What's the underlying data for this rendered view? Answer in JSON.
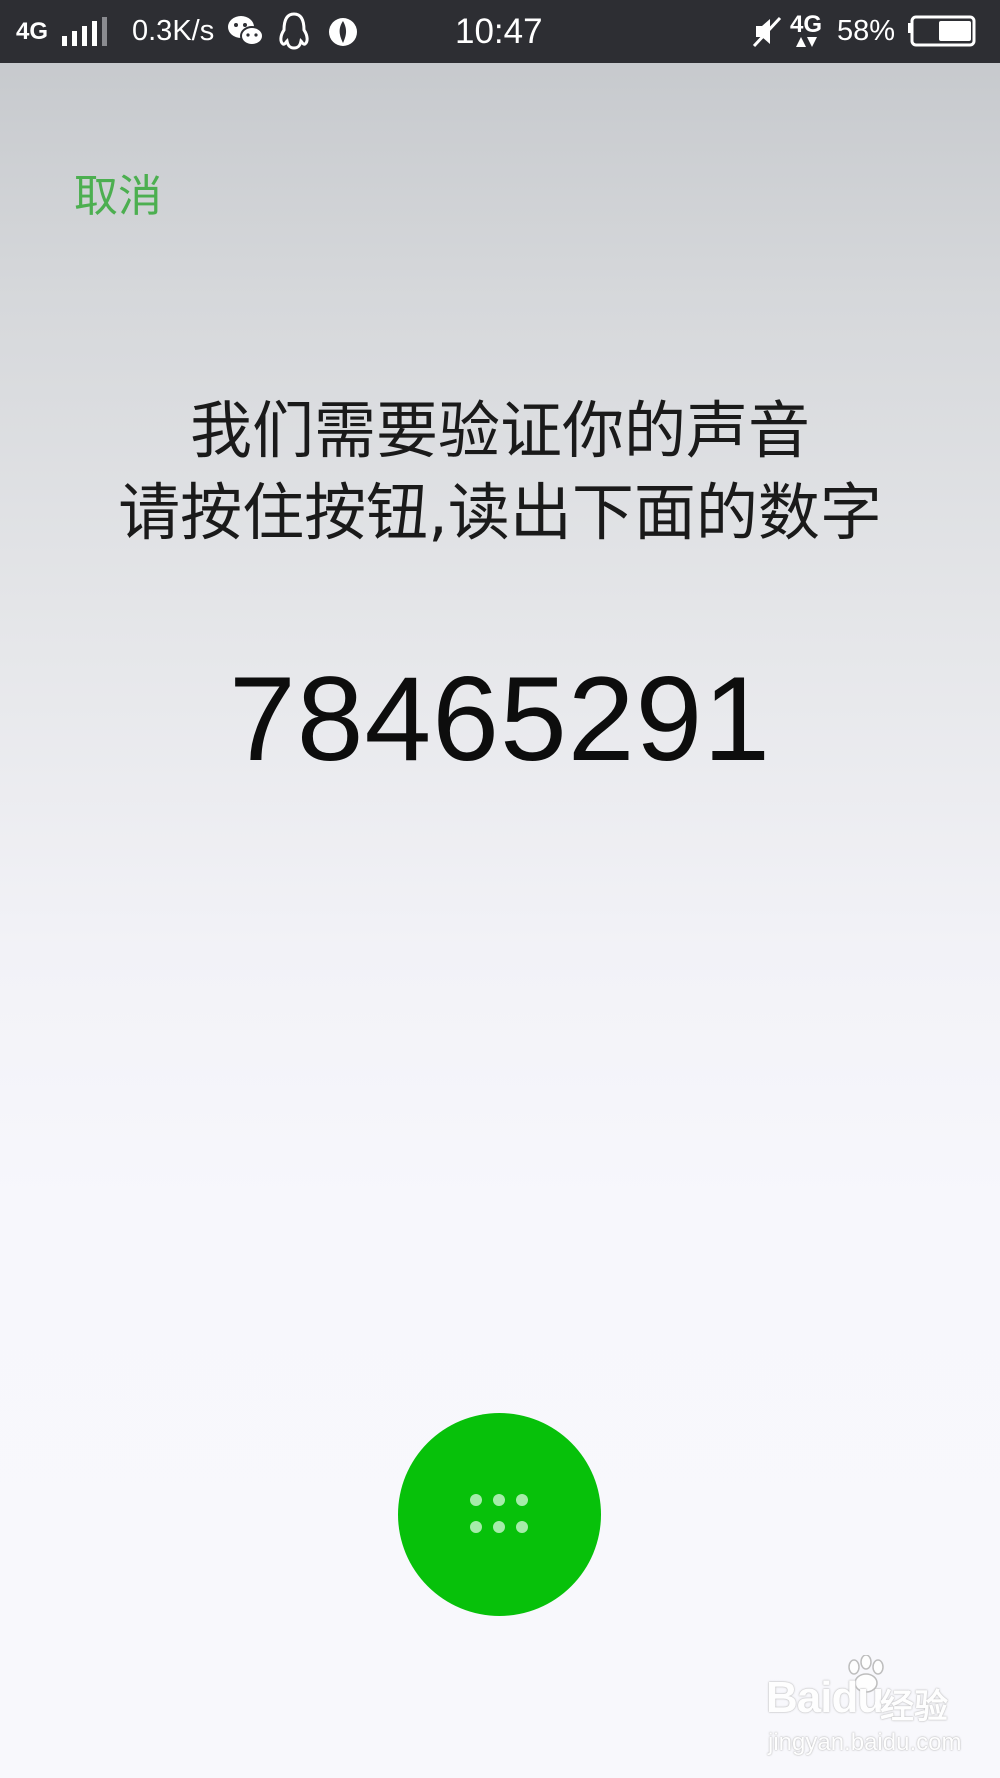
{
  "status_bar": {
    "network_left": "4G",
    "speed": "0.3K/s",
    "time": "10:47",
    "network_right": "4G",
    "battery_percent": "58%",
    "battery_level": 0.58,
    "icons": [
      "signal-icon",
      "wechat-icon",
      "qq-icon",
      "app-icon",
      "mute-icon",
      "data-arrows-icon",
      "battery-icon"
    ]
  },
  "header": {
    "cancel_label": "取消"
  },
  "main": {
    "instruction_line1": "我们需要验证你的声音",
    "instruction_line2": "请按住按钮,读出下面的数字",
    "digits": "78465291"
  },
  "record_button": {
    "icon": "keypad-dots-icon",
    "color": "#07c10a"
  },
  "watermark": {
    "brand": "Baidu",
    "brand_cn": "经验",
    "url": "jingyan.baidu.com"
  },
  "colors": {
    "accent_green": "#4caf50",
    "button_green": "#07c10a",
    "status_bar_bg": "#2d2e33"
  }
}
